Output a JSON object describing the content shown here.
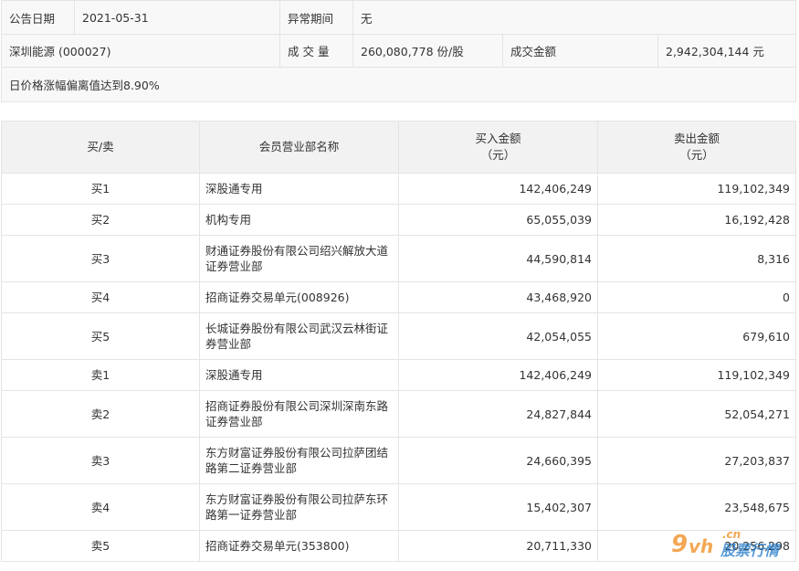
{
  "info": {
    "announce_date_label": "公告日期",
    "announce_date": "2021-05-31",
    "abnormal_period_label": "异常期间",
    "abnormal_period": "无",
    "stock": "深圳能源 (000027)",
    "volume_label": "成 交 量",
    "volume": "260,080,778 份/股",
    "turnover_label": "成交金额",
    "turnover": "2,942,304,144 元",
    "reason": "日价格涨幅偏离值达到8.90%"
  },
  "table": {
    "headers": {
      "side": "买/卖",
      "branch": "会员营业部名称",
      "buy_line1": "买入金额",
      "buy_line2": "（元）",
      "sell_line1": "卖出金额",
      "sell_line2": "（元）"
    },
    "rows": [
      {
        "side": "买1",
        "branch": "深股通专用",
        "buy": "142,406,249",
        "sell": "119,102,349"
      },
      {
        "side": "买2",
        "branch": "机构专用",
        "buy": "65,055,039",
        "sell": "16,192,428"
      },
      {
        "side": "买3",
        "branch": "财通证券股份有限公司绍兴解放大道证券营业部",
        "buy": "44,590,814",
        "sell": "8,316"
      },
      {
        "side": "买4",
        "branch": "招商证券交易单元(008926)",
        "buy": "43,468,920",
        "sell": "0"
      },
      {
        "side": "买5",
        "branch": "长城证券股份有限公司武汉云林街证券营业部",
        "buy": "42,054,055",
        "sell": "679,610"
      },
      {
        "side": "卖1",
        "branch": "深股通专用",
        "buy": "142,406,249",
        "sell": "119,102,349"
      },
      {
        "side": "卖2",
        "branch": "招商证券股份有限公司深圳深南东路证券营业部",
        "buy": "24,827,844",
        "sell": "52,054,271"
      },
      {
        "side": "卖3",
        "branch": "东方财富证券股份有限公司拉萨团结路第二证券营业部",
        "buy": "24,660,395",
        "sell": "27,203,837"
      },
      {
        "side": "卖4",
        "branch": "东方财富证券股份有限公司拉萨东环路第一证券营业部",
        "buy": "15,402,307",
        "sell": "23,548,675"
      },
      {
        "side": "卖5",
        "branch": "招商证券交易单元(353800)",
        "buy": "20,711,330",
        "sell": "20,256,298"
      }
    ]
  },
  "watermark": {
    "nine": "9",
    "vh": "vh",
    "cn": ".cn",
    "text": "股票行情"
  }
}
